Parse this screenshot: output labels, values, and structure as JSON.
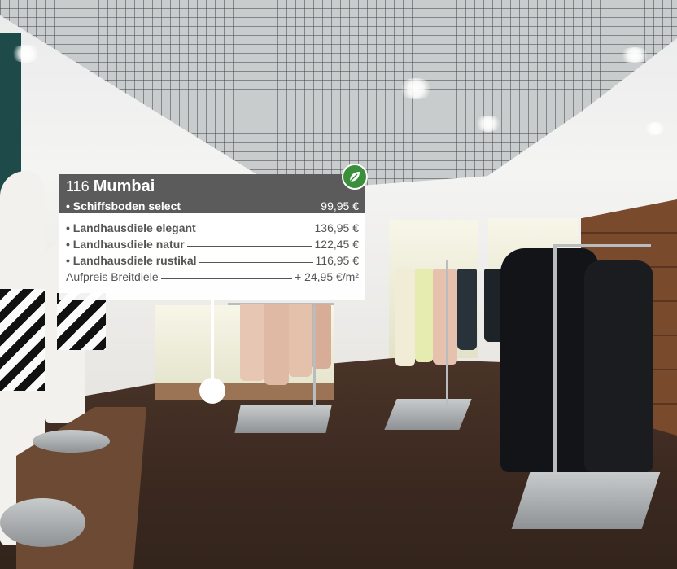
{
  "product": {
    "number": "116",
    "name": "Mumbai",
    "badge_icon": "leaf-eco-icon"
  },
  "featured_option": {
    "label": "• Schiffsboden select",
    "price": "99,95 €"
  },
  "options": [
    {
      "label": "• Landhausdiele elegant",
      "price": "136,95 €"
    },
    {
      "label": "• Landhausdiele natur",
      "price": "122,45 €"
    },
    {
      "label": "• Landhausdiele rustikal",
      "price": "116,95 €"
    }
  ],
  "surcharge": {
    "label": "Aufpreis Breitdiele",
    "price": "+ 24,95 €/m²"
  },
  "colors": {
    "panel_header": "#5b5b5b",
    "badge_green": "#3a8f3a",
    "floor": "#3d2a21"
  }
}
